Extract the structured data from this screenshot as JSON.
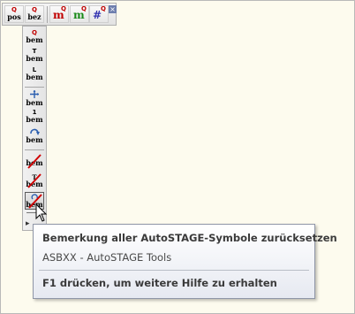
{
  "top_toolbar": {
    "buttons": [
      {
        "top": "Q",
        "bottom": "pos",
        "icon": "q-pos-icon"
      },
      {
        "top": "Q",
        "bottom": "bez",
        "icon": "q-bez-icon"
      },
      {
        "sup": "Q",
        "main": "m",
        "color": "#c00000",
        "icon": "q-m-red-icon"
      },
      {
        "sup": "Q",
        "main": "m",
        "color": "#1a8a1a",
        "icon": "q-m-green-icon"
      },
      {
        "sup": "Q",
        "main": "#",
        "color": "#3030b0",
        "icon": "q-hash-icon"
      }
    ],
    "close": "×"
  },
  "side_toolbar": {
    "buttons": [
      {
        "top": "Q",
        "bottom": "bem",
        "icon": "q-bem-icon"
      },
      {
        "top": "T",
        "bottom": "bem",
        "icon": "t-bem-icon"
      },
      {
        "top": "L",
        "bottom": "bem",
        "icon": "l-bem-icon"
      },
      {
        "top": "",
        "bottom": "bem",
        "icon": "move-bem-icon"
      },
      {
        "top": "1",
        "bottom": "bem",
        "icon": "one-bem-icon"
      },
      {
        "top": "",
        "bottom": "bem",
        "icon": "rotate-bem-icon"
      },
      {
        "top": "",
        "bottom": "bem",
        "icon": "delete-bem-icon"
      },
      {
        "top": "",
        "bottom": "bem",
        "icon": "delete-t-bem-icon"
      },
      {
        "top": "",
        "bottom": "bem",
        "icon": "reset-bem-icon",
        "active": true
      }
    ],
    "more": "▸"
  },
  "tooltip": {
    "title": "Bemerkung aller AutoSTAGE-Symbole zurücksetzen",
    "subtitle": "ASBXX - AutoSTAGE Tools",
    "help": "F1 drücken, um weitere Hilfe zu erhalten"
  }
}
